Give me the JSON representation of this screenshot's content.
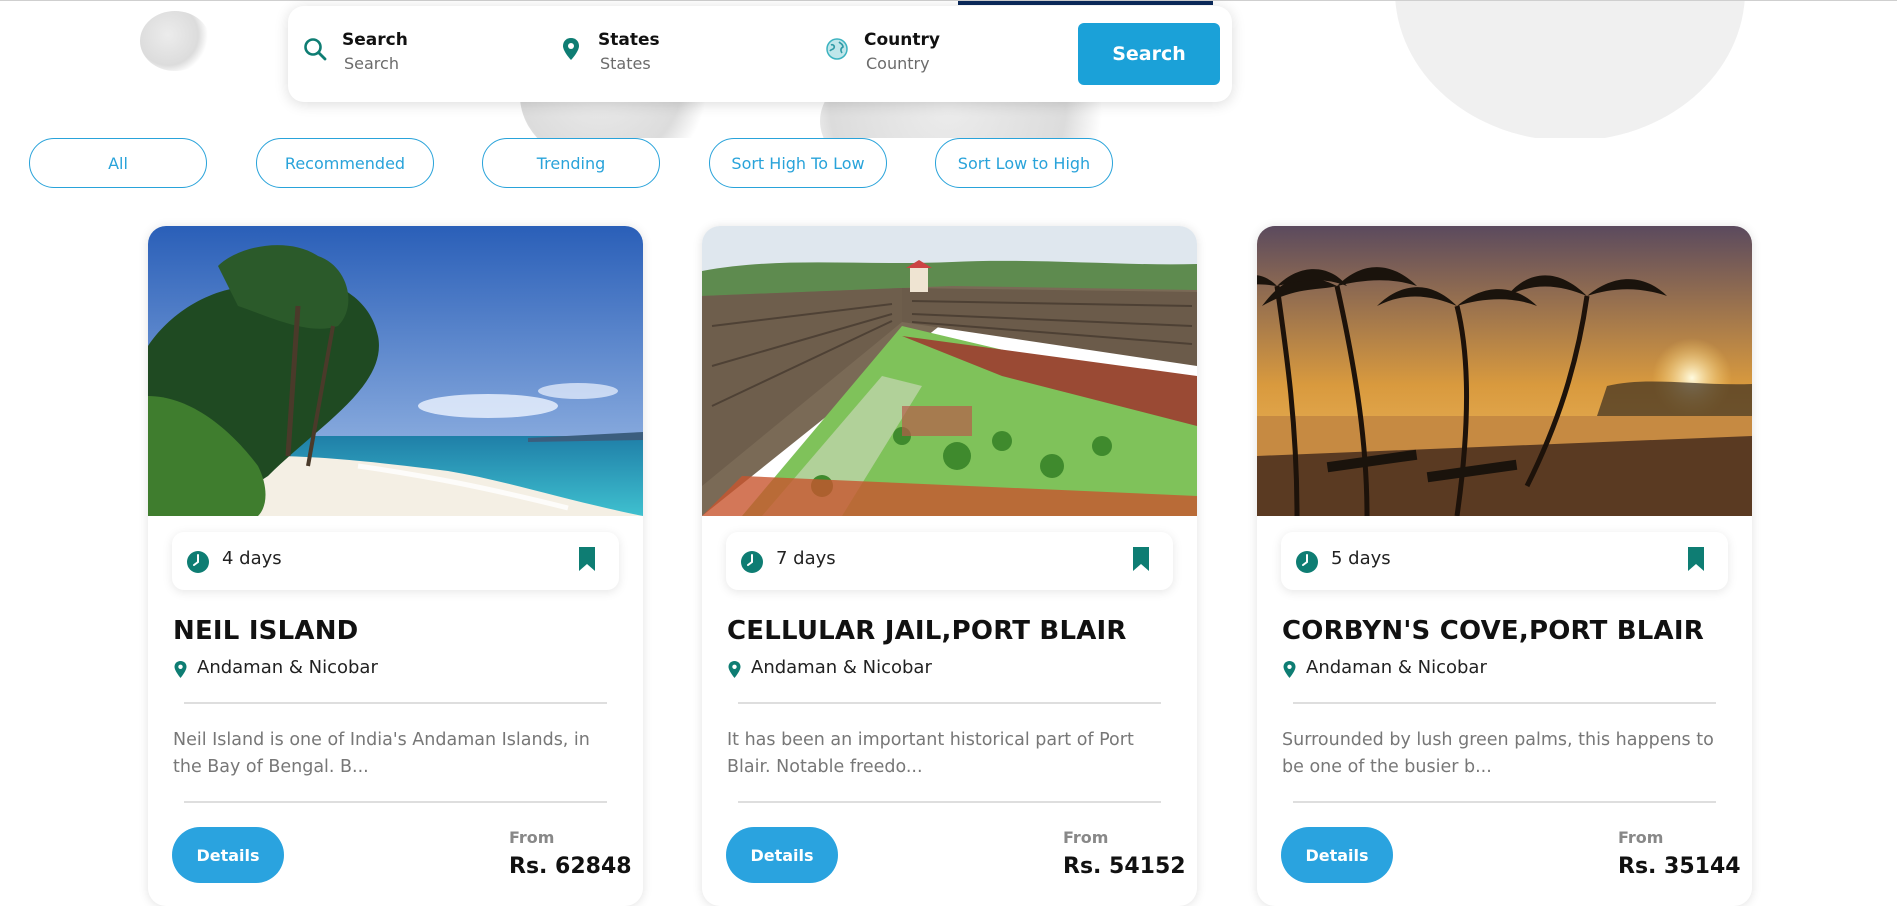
{
  "search_bar": {
    "fields": [
      {
        "label": "Search",
        "placeholder": "Search",
        "icon": "search-icon"
      },
      {
        "label": "States",
        "placeholder": "States",
        "icon": "map-pin-icon"
      },
      {
        "label": "Country",
        "placeholder": "Country",
        "icon": "globe-icon"
      }
    ],
    "button_label": "Search"
  },
  "filters": [
    "All",
    "Recommended",
    "Trending",
    "Sort High To Low",
    "Sort Low to High"
  ],
  "cards": [
    {
      "image": "beach-photo",
      "duration": "4 days",
      "title": "NEIL ISLAND",
      "location": "Andaman & Nicobar",
      "description": "Neil Island is one of India's Andaman Islands, in the Bay of Bengal. B...",
      "details_label": "Details",
      "from_label": "From",
      "price": "Rs. 62848"
    },
    {
      "image": "jail-photo",
      "duration": "7 days",
      "title": "CELLULAR JAIL,PORT BLAIR",
      "location": "Andaman & Nicobar",
      "description": "It has been an important historical part of Port Blair. Notable freedo...",
      "details_label": "Details",
      "from_label": "From",
      "price": "Rs. 54152"
    },
    {
      "image": "sunset-palms-photo",
      "duration": "5 days",
      "title": "CORBYN'S COVE,PORT BLAIR",
      "location": "Andaman & Nicobar",
      "description": "Surrounded by lush green palms, this happens to be one of the busier b...",
      "details_label": "Details",
      "from_label": "From",
      "price": "Rs. 35144"
    }
  ],
  "colors": {
    "accent": "#1ba1d8",
    "icon_teal": "#0e7d73",
    "price_text": "#111111",
    "muted_text": "#777777"
  }
}
